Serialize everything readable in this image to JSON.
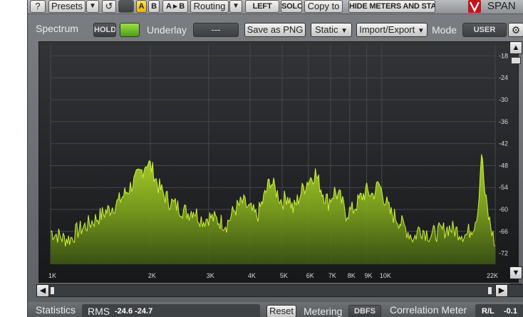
{
  "toolbar": {
    "help": "?",
    "presets": "Presets",
    "dropdown1": "▼",
    "undo": "↺",
    "redo": "",
    "a": "A",
    "b": "B",
    "ab": "A ▸ B",
    "routing": "Routing",
    "dropdown2": "▼",
    "left": "LEFT",
    "solo": "SOLO",
    "copy_to": "Copy to",
    "hide_meters": "HIDE METERS AND STATS",
    "brand": "SPAN"
  },
  "spectrum_row": {
    "title": "Spectrum",
    "hold": "HOLD",
    "underlay_label": "Underlay",
    "underlay_value": "---",
    "save_png": "Save as PNG",
    "static": "Static",
    "import_export": "Import/Export",
    "dropdown": "▼",
    "mode_label": "Mode",
    "mode_value": "USER"
  },
  "db_ticks": [
    "-18",
    "-24",
    "-30",
    "-36",
    "-42",
    "-48",
    "-54",
    "-60",
    "-66",
    "-72"
  ],
  "freq_ticks": [
    "1K",
    "2K",
    "3K",
    "4K",
    "5K",
    "6K",
    "7K",
    "8K",
    "9K",
    "10K",
    "22K"
  ],
  "chart_data": {
    "type": "area",
    "x_unit": "Hz",
    "y_unit": "dB",
    "xlim": [
      1000,
      22000
    ],
    "ylim": [
      -75,
      -15
    ],
    "x_scale": "log",
    "grid": true,
    "series": [
      {
        "color": "#8fbf1a",
        "x": [
          1000,
          1050,
          1100,
          1150,
          1200,
          1300,
          1400,
          1500,
          1600,
          1700,
          1800,
          1900,
          1950,
          2000,
          2050,
          2100,
          2200,
          2300,
          2400,
          2500,
          2600,
          2700,
          2800,
          2900,
          3000,
          3200,
          3400,
          3600,
          3800,
          4000,
          4200,
          4400,
          4600,
          4800,
          5000,
          5200,
          5400,
          5600,
          5800,
          6000,
          6300,
          6600,
          6900,
          7200,
          7500,
          7800,
          8200,
          8600,
          9000,
          9400,
          9800,
          10200,
          10600,
          11000,
          11500,
          12000,
          12500,
          13000,
          14000,
          15000,
          16000,
          17000,
          18000,
          19000,
          19500,
          20000,
          20500,
          21000,
          22000
        ],
        "y": [
          -66,
          -67,
          -68,
          -68,
          -66,
          -64,
          -62,
          -60,
          -58,
          -55,
          -52,
          -49,
          -47,
          -48,
          -50,
          -53,
          -56,
          -58,
          -59,
          -60,
          -61,
          -60,
          -62,
          -63,
          -62,
          -63,
          -64,
          -60,
          -58,
          -60,
          -62,
          -57,
          -52,
          -55,
          -58,
          -56,
          -60,
          -57,
          -54,
          -52,
          -50,
          -55,
          -58,
          -55,
          -57,
          -61,
          -60,
          -57,
          -55,
          -56,
          -53,
          -57,
          -61,
          -62,
          -64,
          -66,
          -68,
          -65,
          -67,
          -66,
          -65,
          -66,
          -67,
          -64,
          -60,
          -44,
          -56,
          -62,
          -70
        ]
      }
    ]
  },
  "bottom": {
    "statistics_label": "Statistics",
    "rms_label": "RMS",
    "rms_value": "-24.6  -24.7",
    "reset": "Reset",
    "metering_label": "Metering",
    "metering_value": "DBFS",
    "correlation_label": "Correlation Meter",
    "rl_label": "R/L",
    "rl_value": "-0.1"
  }
}
